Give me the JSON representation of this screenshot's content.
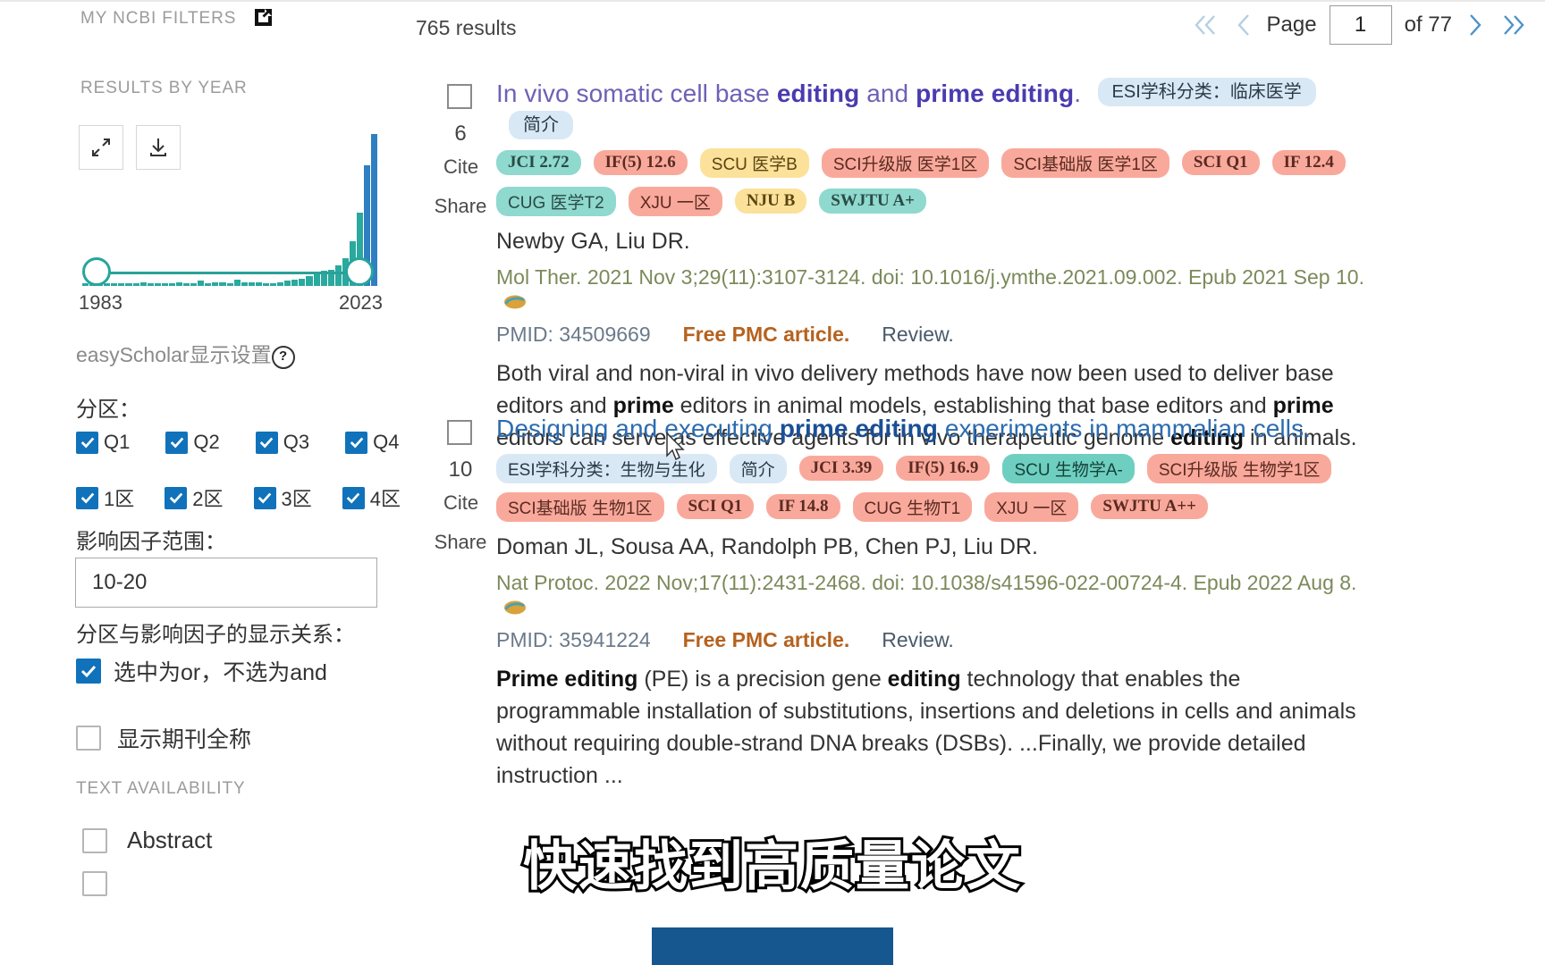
{
  "sidebar": {
    "my_ncbi_filters": "MY NCBI FILTERS",
    "results_by_year": "RESULTS BY YEAR",
    "expand_icon": "expand-icon",
    "download_icon": "download-icon",
    "year_start": "1983",
    "year_end": "2023",
    "easyscholar_title": "easyScholar显示设置",
    "help_icon": "?",
    "fenqu_label": "分区：",
    "quartiles": [
      {
        "label": "Q1",
        "checked": true
      },
      {
        "label": "Q2",
        "checked": true
      },
      {
        "label": "Q3",
        "checked": true
      },
      {
        "label": "Q4",
        "checked": true
      }
    ],
    "zones": [
      {
        "label": "1区",
        "checked": true
      },
      {
        "label": "2区",
        "checked": true
      },
      {
        "label": "3区",
        "checked": true
      },
      {
        "label": "4区",
        "checked": true
      }
    ],
    "if_range_label": "影响因子范围：",
    "if_range_value": "10-20",
    "relation_label": "分区与影响因子的显示关系：",
    "relation_option": "选中为or，不选为and",
    "relation_checked": true,
    "journal_full_name": "显示期刊全称",
    "journal_full_name_checked": false,
    "text_availability": "TEXT AVAILABILITY",
    "abstract_label": "Abstract",
    "abstract_checked": false
  },
  "chart_data": {
    "type": "bar",
    "title": "RESULTS BY YEAR",
    "xlabel": "",
    "ylabel": "",
    "grid": false,
    "legend": "none",
    "categories": [
      "1983",
      "1984",
      "1985",
      "1986",
      "1987",
      "1988",
      "1989",
      "1990",
      "1991",
      "1992",
      "1993",
      "1994",
      "1995",
      "1996",
      "1997",
      "1998",
      "1999",
      "2000",
      "2001",
      "2002",
      "2003",
      "2004",
      "2005",
      "2006",
      "2007",
      "2008",
      "2009",
      "2010",
      "2011",
      "2012",
      "2013",
      "2014",
      "2015",
      "2016",
      "2017",
      "2018",
      "2019",
      "2020",
      "2021",
      "2022",
      "2023"
    ],
    "values": [
      1,
      1,
      1,
      1,
      2,
      1,
      2,
      2,
      3,
      2,
      2,
      2,
      2,
      3,
      2,
      2,
      4,
      2,
      3,
      3,
      2,
      5,
      3,
      3,
      3,
      2,
      2,
      3,
      4,
      5,
      6,
      8,
      10,
      12,
      13,
      16,
      22,
      35,
      58,
      95,
      120
    ],
    "ylim": [
      0,
      125
    ],
    "bar_color_low": "#2aa99e",
    "bar_color_high": "#2f7fc1"
  },
  "main": {
    "results_count": "765 results",
    "pager": {
      "first_icon": "double-chevron-left-icon",
      "prev_icon": "chevron-left-icon",
      "page_label": "Page",
      "page_value": "1",
      "of_label": "of 77",
      "next_icon": "chevron-right-icon",
      "last_icon": "double-chevron-right-icon"
    },
    "results": [
      {
        "number": "6",
        "cite": "Cite",
        "share": "Share",
        "title_parts": [
          {
            "text": "In vivo somatic cell base ",
            "bold": false
          },
          {
            "text": "editing",
            "bold": true
          },
          {
            "text": " and ",
            "bold": false
          },
          {
            "text": "prime editing",
            "bold": true
          },
          {
            "text": ".",
            "bold": false
          }
        ],
        "title_plain": "In vivo somatic cell base editing and prime editing.",
        "title_color": "purple",
        "inline_badges": [
          {
            "text": "ESI学科分类：临床医学",
            "bg": "#d9e8f5",
            "fg": "#2b3a4a",
            "cn": true
          },
          {
            "text": "简介",
            "bg": "#d9e8f5",
            "fg": "#2b3a4a",
            "cn": true
          }
        ],
        "badges": [
          {
            "text": "JCI 2.72",
            "bg": "#8fd9cf",
            "fg": "#2a4a44"
          },
          {
            "text": "IF(5) 12.6",
            "bg": "#f9a99b",
            "fg": "#5a2a22"
          },
          {
            "text": "SCU 医学B",
            "bg": "#fbe19a",
            "fg": "#5a4410",
            "cn": true
          },
          {
            "text": "SCI升级版 医学1区",
            "bg": "#f9a99b",
            "fg": "#5a2a22",
            "cn": true
          },
          {
            "text": "SCI基础版 医学1区",
            "bg": "#f9a99b",
            "fg": "#5a2a22",
            "cn": true
          },
          {
            "text": "SCI Q1",
            "bg": "#f9a99b",
            "fg": "#5a2a22"
          },
          {
            "text": "IF 12.4",
            "bg": "#f9a99b",
            "fg": "#5a2a22"
          },
          {
            "text": "CUG 医学T2",
            "bg": "#8fd9cf",
            "fg": "#2a4a44",
            "cn": true
          },
          {
            "text": "XJU 一区",
            "bg": "#f9a99b",
            "fg": "#5a2a22",
            "cn": true
          },
          {
            "text": "NJU B",
            "bg": "#fbe19a",
            "fg": "#5a4410"
          },
          {
            "text": "SWJTU A+",
            "bg": "#8fd9cf",
            "fg": "#2a4a44"
          }
        ],
        "authors": "Newby GA, Liu DR.",
        "citation": "Mol Ther. 2021 Nov 3;29(11):3107-3124. doi: 10.1016/j.ymthe.2021.09.002. Epub 2021 Sep 10.",
        "pmid": "PMID: 34509669",
        "free_article": "Free PMC article.",
        "review": "Review.",
        "snippet_parts": [
          {
            "text": "Both viral and non-viral in vivo delivery methods have now been used to deliver base editors and ",
            "bold": false
          },
          {
            "text": "prime",
            "bold": true
          },
          {
            "text": " editors in animal models, establishing that base editors and ",
            "bold": false
          },
          {
            "text": "prime",
            "bold": true
          },
          {
            "text": " editors can serve as effective agents for in vivo therapeutic genome ",
            "bold": false
          },
          {
            "text": "editing",
            "bold": true
          },
          {
            "text": " in animals. ...",
            "bold": false
          }
        ]
      },
      {
        "number": "10",
        "cite": "Cite",
        "share": "Share",
        "title_parts": [
          {
            "text": "Designing and executing ",
            "bold": false
          },
          {
            "text": "prime editing",
            "bold": true
          },
          {
            "text": " experiments in mammalian cells.",
            "bold": false
          }
        ],
        "title_plain": "Designing and executing prime editing experiments in mammalian cells.",
        "title_color": "blue",
        "inline_badges": [],
        "badges": [
          {
            "text": "ESI学科分类：生物与生化",
            "bg": "#d9e8f5",
            "fg": "#2b3a4a",
            "cn": true
          },
          {
            "text": "简介",
            "bg": "#d9e8f5",
            "fg": "#2b3a4a",
            "cn": true
          },
          {
            "text": "JCI 3.39",
            "bg": "#f9a99b",
            "fg": "#5a2a22"
          },
          {
            "text": "IF(5) 16.9",
            "bg": "#f9a99b",
            "fg": "#5a2a22"
          },
          {
            "text": "SCU 生物学A-",
            "bg": "#6ecfc0",
            "fg": "#15423a",
            "cn": true
          },
          {
            "text": "SCI升级版 生物学1区",
            "bg": "#f9a99b",
            "fg": "#5a2a22",
            "cn": true
          },
          {
            "text": "SCI基础版 生物1区",
            "bg": "#f9a99b",
            "fg": "#5a2a22",
            "cn": true
          },
          {
            "text": "SCI Q1",
            "bg": "#f9a99b",
            "fg": "#5a2a22"
          },
          {
            "text": "IF 14.8",
            "bg": "#f9a99b",
            "fg": "#5a2a22"
          },
          {
            "text": "CUG 生物T1",
            "bg": "#f9a99b",
            "fg": "#5a2a22",
            "cn": true
          },
          {
            "text": "XJU 一区",
            "bg": "#f9a99b",
            "fg": "#5a2a22",
            "cn": true
          },
          {
            "text": "SWJTU A++",
            "bg": "#f9a99b",
            "fg": "#5a2a22"
          }
        ],
        "authors": "Doman JL, Sousa AA, Randolph PB, Chen PJ, Liu DR.",
        "citation": "Nat Protoc. 2022 Nov;17(11):2431-2468. doi: 10.1038/s41596-022-00724-4. Epub 2022 Aug 8.",
        "pmid": "PMID: 35941224",
        "free_article": "Free PMC article.",
        "review": "Review.",
        "snippet_parts": [
          {
            "text": "Prime editing",
            "bold": true
          },
          {
            "text": " (PE) is a precision gene ",
            "bold": false
          },
          {
            "text": "editing",
            "bold": true
          },
          {
            "text": " technology that enables the programmable installation of substitutions, insertions and deletions in cells and animals without requiring double-strand DNA breaks (DSBs). ...Finally, we provide detailed instruction ...",
            "bold": false
          }
        ]
      }
    ]
  },
  "overlay": {
    "caption": "快速找到高质量论文",
    "caption_bar_color": "#17578f"
  }
}
